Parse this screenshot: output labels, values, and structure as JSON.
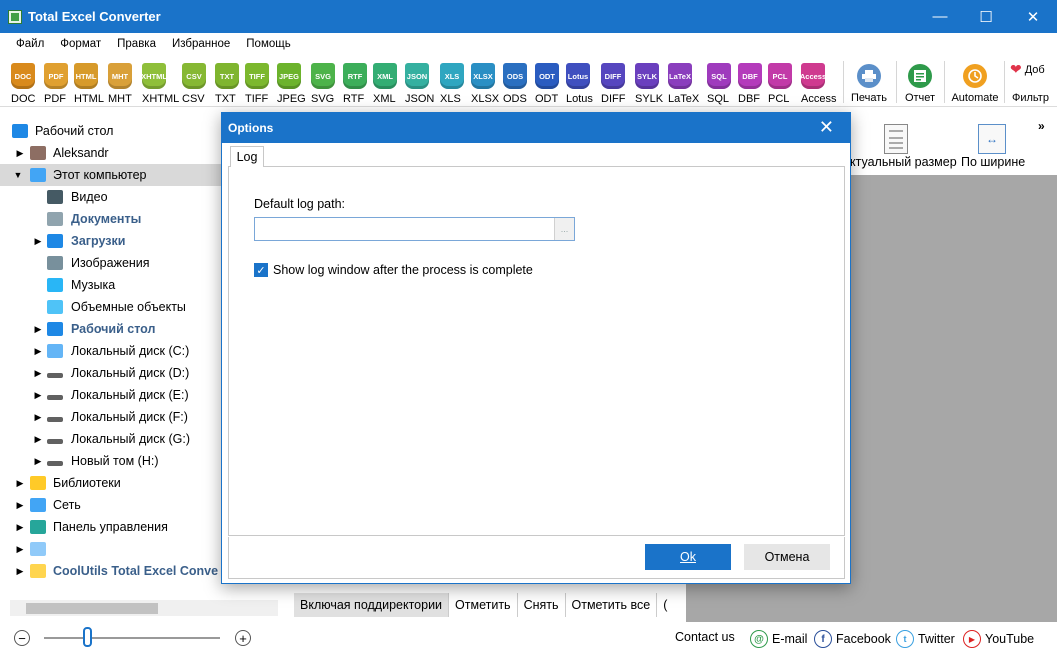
{
  "window": {
    "title": "Total Excel Converter",
    "minimize": "—",
    "maximize": "☐",
    "close": "✕"
  },
  "menu": [
    "Файл",
    "Формат",
    "Правка",
    "Избранное",
    "Помощь"
  ],
  "formats": [
    {
      "label": "DOC",
      "icon": "DOC",
      "color": "#d98a1c"
    },
    {
      "label": "PDF",
      "icon": "PDF",
      "color": "#e0a030"
    },
    {
      "label": "HTML",
      "icon": "HTML",
      "color": "#d79a2a"
    },
    {
      "label": "MHT",
      "icon": "MHT",
      "color": "#d9a039"
    },
    {
      "label": "XHTML",
      "icon": "XHTML",
      "color": "#8fbf3a"
    },
    {
      "label": "CSV",
      "icon": "CSV",
      "color": "#86b833"
    },
    {
      "label": "TXT",
      "icon": "TXT",
      "color": "#7fb52f"
    },
    {
      "label": "TIFF",
      "icon": "TIFF",
      "color": "#7cb82e"
    },
    {
      "label": "JPEG",
      "icon": "JPEG",
      "color": "#6cb32c"
    },
    {
      "label": "SVG",
      "icon": "SVG",
      "color": "#4db34a"
    },
    {
      "label": "RTF",
      "icon": "RTF",
      "color": "#3cae5a"
    },
    {
      "label": "XML",
      "icon": "XML",
      "color": "#33ad73"
    },
    {
      "label": "JSON",
      "icon": "JSON",
      "color": "#35b0a0"
    },
    {
      "label": "XLS",
      "icon": "XLS",
      "color": "#2fa6c0"
    },
    {
      "label": "XLSX",
      "icon": "XLSX",
      "color": "#2a8fc4"
    },
    {
      "label": "ODS",
      "icon": "ODS",
      "color": "#2a6fc0"
    },
    {
      "label": "ODT",
      "icon": "ODT",
      "color": "#2a5cc0"
    },
    {
      "label": "Lotus",
      "icon": "Lotus",
      "color": "#3f4fbf"
    },
    {
      "label": "DIFF",
      "icon": "DIFF",
      "color": "#5646bf"
    },
    {
      "label": "SYLK",
      "icon": "SYLK",
      "color": "#6a3fbe"
    },
    {
      "label": "LaTeX",
      "icon": "LaTeX",
      "color": "#8a3ebd"
    },
    {
      "label": "SQL",
      "icon": "SQL",
      "color": "#9f3bbd"
    },
    {
      "label": "DBF",
      "icon": "DBF",
      "color": "#b43bbb"
    },
    {
      "label": "PCL",
      "icon": "PCL",
      "color": "#c23aa8"
    },
    {
      "label": "Access",
      "icon": "Access",
      "color": "#cf3a8f"
    }
  ],
  "actions": {
    "print": "Печать",
    "report": "Отчет",
    "automate": "Automate",
    "donate": "Доб",
    "filter": "Фильтр"
  },
  "tree": [
    {
      "label": "Рабочий стол",
      "icon": "desktop-icon",
      "bold": false
    },
    {
      "label": "Aleksandr",
      "icon": "user-icon",
      "bold": false
    },
    {
      "label": "Этот компьютер",
      "icon": "computer-icon",
      "bold": false
    },
    {
      "label": "Видео",
      "icon": "video-folder-icon",
      "bold": false
    },
    {
      "label": "Документы",
      "icon": "documents-folder-icon",
      "bold": true
    },
    {
      "label": "Загрузки",
      "icon": "downloads-folder-icon",
      "bold": true
    },
    {
      "label": "Изображения",
      "icon": "pictures-folder-icon",
      "bold": false
    },
    {
      "label": "Музыка",
      "icon": "music-folder-icon",
      "bold": false
    },
    {
      "label": "Объемные объекты",
      "icon": "3d-objects-folder-icon",
      "bold": false
    },
    {
      "label": "Рабочий стол",
      "icon": "desktop-folder-icon",
      "bold": true
    },
    {
      "label": "Локальный диск (C:)",
      "icon": "system-drive-icon",
      "bold": false
    },
    {
      "label": "Локальный диск (D:)",
      "icon": "drive-icon",
      "bold": false
    },
    {
      "label": "Локальный диск (E:)",
      "icon": "drive-icon",
      "bold": false
    },
    {
      "label": "Локальный диск (F:)",
      "icon": "drive-icon",
      "bold": false
    },
    {
      "label": "Локальный диск (G:)",
      "icon": "drive-icon",
      "bold": false
    },
    {
      "label": "Новый том (H:)",
      "icon": "drive-icon",
      "bold": false
    },
    {
      "label": "Библиотеки",
      "icon": "libraries-icon",
      "bold": false
    },
    {
      "label": "Сеть",
      "icon": "network-icon",
      "bold": false
    },
    {
      "label": "Панель управления",
      "icon": "control-panel-icon",
      "bold": false
    },
    {
      "label": "",
      "icon": "recycle-bin-icon",
      "bold": false
    },
    {
      "label": "CoolUtils Total Excel Conve",
      "icon": "folder-icon",
      "bold": true
    }
  ],
  "preview": {
    "actual_size": "ктуальный размер",
    "fit_width": "По ширине"
  },
  "file_actions": [
    "Включая поддиректории",
    "Отметить",
    "Снять",
    "Отметить все",
    "("
  ],
  "status": {
    "contact": "Contact us",
    "email": "E-mail",
    "facebook": "Facebook",
    "twitter": "Twitter",
    "youtube": "YouTube",
    "zoom_out": "−",
    "zoom_in": "+"
  },
  "dialog": {
    "title": "Options",
    "close": "✕",
    "tab": "Log",
    "log_path_label": "Default log path:",
    "log_path_value": "",
    "browse": "...",
    "show_log_label": "Show log window after the process is complete",
    "show_log_checked": true,
    "ok": "Ok",
    "cancel": "Отмена"
  },
  "colors": {
    "accent": "#1a73c9",
    "preview_bg": "#a7a7a7"
  }
}
